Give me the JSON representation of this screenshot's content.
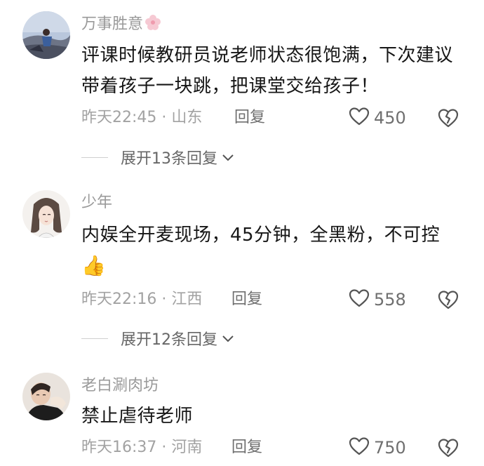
{
  "comments": [
    {
      "username": "万事胜意",
      "text": "评课时候教研员说老师状态很饱满，下次建议带着孩子一块跳，把课堂交给孩子！",
      "time": "昨天22:45",
      "sep": "·",
      "location": "山东",
      "reply_label": "回复",
      "likes": "450",
      "expand_label": "展开13条回复"
    },
    {
      "username": "少年",
      "text": "内娱全开麦现场，45分钟，全黑粉，不可控",
      "emoji": "👍",
      "time": "昨天22:16",
      "sep": "·",
      "location": "江西",
      "reply_label": "回复",
      "likes": "558",
      "expand_label": "展开12条回复"
    },
    {
      "username": "老白涮肉坊",
      "text": "禁止虐待老师",
      "time": "昨天16:37",
      "sep": "·",
      "location": "河南",
      "reply_label": "回复",
      "likes": "750"
    }
  ],
  "icons": {
    "like": "heart-outline-icon",
    "dislike": "broken-heart-icon",
    "expand": "chevron-down-icon",
    "badge": "flower-icon"
  },
  "colors": {
    "text": "#161616",
    "meta": "#a2a2a2",
    "username": "#9a9a9a"
  }
}
